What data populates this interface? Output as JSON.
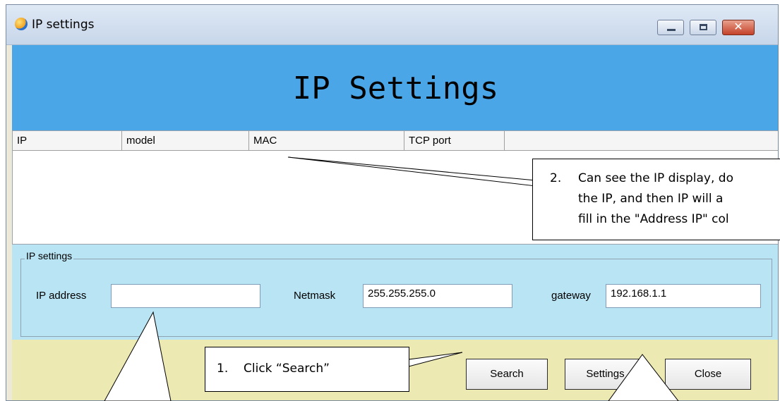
{
  "window": {
    "title": "IP settings",
    "buttons": {
      "minimize": "",
      "maximize": "",
      "close": "✕"
    }
  },
  "banner": {
    "title": "IP Settings"
  },
  "device_list": {
    "columns": [
      "IP",
      "model",
      "MAC",
      "TCP port",
      ""
    ],
    "rows": []
  },
  "ip_settings": {
    "group_label": "IP settings",
    "ip_address_label": "IP address",
    "ip_address_value": "",
    "netmask_label": "Netmask",
    "netmask_value": "255.255.255.0",
    "gateway_label": "gateway",
    "gateway_value": "192.168.1.1"
  },
  "buttons": {
    "search": "Search",
    "settings": "Settings",
    "close": "Close"
  },
  "annotations": {
    "step1": {
      "number": "1.",
      "text": "Click “Search”"
    },
    "step2": {
      "number": "2.",
      "lines": [
        "Can see the IP display, do",
        "the IP, and then IP will a",
        "fill in the \"Address IP\" col"
      ]
    }
  }
}
